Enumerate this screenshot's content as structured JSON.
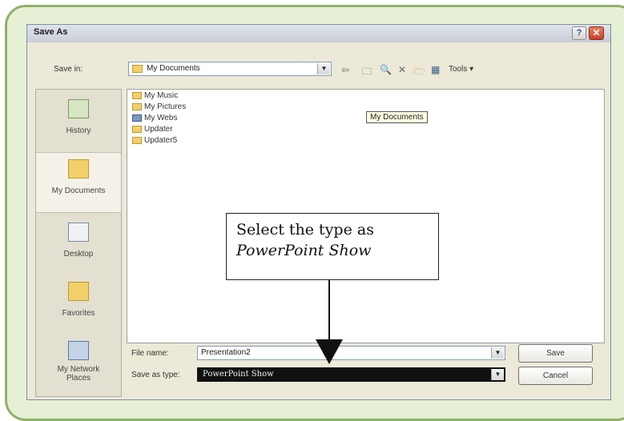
{
  "dialog": {
    "title": "Save As",
    "help_label": "?",
    "close_label": "✕",
    "save_in_label": "Save in:",
    "save_in_value": "My Documents",
    "tools_label": "Tools ▾",
    "places": [
      {
        "label": "History",
        "icon": "history-icon"
      },
      {
        "label": "My Documents",
        "icon": "my-documents-icon",
        "selected": true
      },
      {
        "label": "Desktop",
        "icon": "desktop-icon"
      },
      {
        "label": "Favorites",
        "icon": "favorites-icon"
      },
      {
        "label": "My Network Places",
        "icon": "network-places-icon"
      }
    ],
    "files": [
      {
        "name": "My Music",
        "icon": "folder-icon"
      },
      {
        "name": "My Pictures",
        "icon": "folder-icon"
      },
      {
        "name": "My Webs",
        "icon": "web-folder-icon"
      },
      {
        "name": "Updater",
        "icon": "folder-icon"
      },
      {
        "name": "Updater5",
        "icon": "folder-icon"
      }
    ],
    "tooltip": "My Documents",
    "file_name_label": "File name:",
    "file_name_value": "Presentation2",
    "save_as_type_label": "Save as type:",
    "save_as_type_value": "PowerPoint Show",
    "save_label": "Save",
    "cancel_label": "Cancel"
  },
  "callout": {
    "line1": "Select the type as",
    "line2": "PowerPoint Show"
  },
  "colors": {
    "frame_border": "#8fb06a",
    "frame_fill": "#e6f0d4",
    "dialog_bg": "#ece9d8",
    "selected_type_bg": "#111111"
  }
}
